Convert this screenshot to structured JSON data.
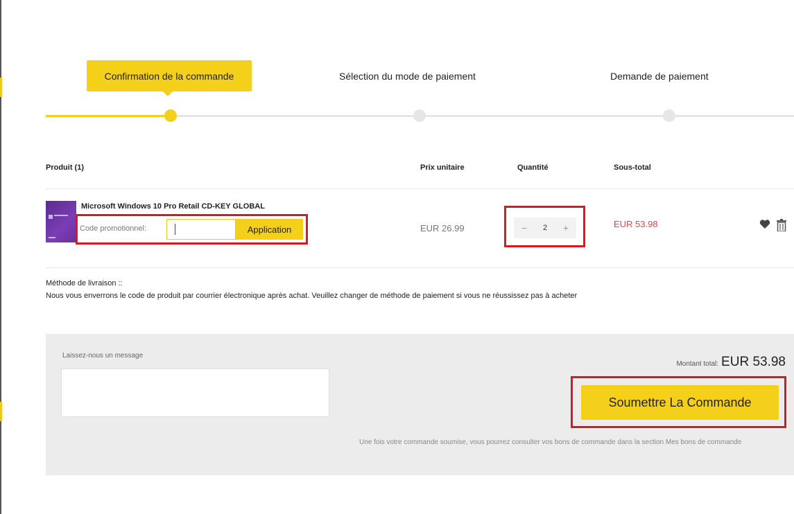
{
  "colors": {
    "accent": "#f5d01a",
    "highlight": "#e0161d",
    "subtotal": "#e2444b"
  },
  "steps": [
    {
      "label": "Confirmation de la commande",
      "active": true
    },
    {
      "label": "Sélection du mode de paiement",
      "active": false
    },
    {
      "label": "Demande de paiement",
      "active": false
    }
  ],
  "table": {
    "headers": {
      "product": "Produit (1)",
      "unit_price": "Prix unitaire",
      "quantity": "Quantité",
      "subtotal": "Sous-total"
    },
    "row": {
      "name": "Microsoft Windows 10 Pro Retail CD-KEY GLOBAL",
      "promo_label": "Code promotionnel:",
      "promo_value": "",
      "apply_label": "Application",
      "unit_price": "EUR 26.99",
      "qty_minus": "−",
      "quantity": "2",
      "qty_plus": "+",
      "subtotal": "EUR 53.98",
      "icons": [
        "heart-icon",
        "trash-icon"
      ]
    }
  },
  "shipping": {
    "title": "Méthode de livraison ::",
    "text": "Nous vous enverrons le code de produit par courrier électronique après achat. Veuillez changer de méthode de paiement si vous ne réussissez pas à acheter"
  },
  "summary": {
    "message_label": "Laissez-nous un message",
    "message_value": "",
    "total_label": "Montant total:",
    "total_value": "EUR 53.98",
    "submit_label": "Soumettre La Commande",
    "note": "Une fois votre commande soumise, vous pourrez consulter vos bons de commande dans la section Mes bons de commande"
  }
}
